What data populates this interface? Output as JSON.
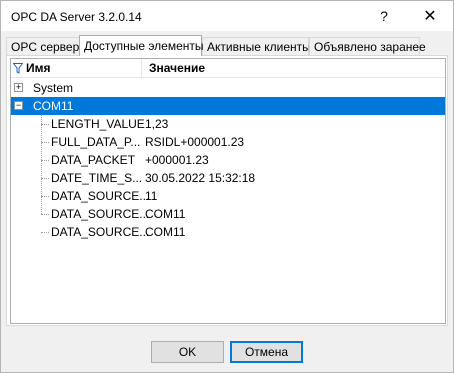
{
  "window": {
    "title": "OPC DA Server 3.2.0.14",
    "help_glyph": "?",
    "close_glyph": "✕"
  },
  "tabs": [
    {
      "label": "OPC сервер",
      "active": false
    },
    {
      "label": "Доступные элементы",
      "active": true
    },
    {
      "label": "Активные клиенты",
      "active": false
    },
    {
      "label": "Объявлено заранее",
      "active": false
    }
  ],
  "grid": {
    "col_name": "Имя",
    "col_value": "Значение",
    "rows": [
      {
        "name": "System",
        "value": "",
        "level": 0,
        "expander": "+",
        "selected": false
      },
      {
        "name": "COM11",
        "value": "",
        "level": 0,
        "expander": "−",
        "selected": true
      },
      {
        "name": "LENGTH_VALUE",
        "value": "1,23",
        "level": 1
      },
      {
        "name": "FULL_DATA_P...",
        "value": "RSIDL+000001.23",
        "level": 1
      },
      {
        "name": "DATA_PACKET",
        "value": "+000001.23",
        "level": 1
      },
      {
        "name": "DATE_TIME_S...",
        "value": "30.05.2022 15:32:18",
        "level": 1
      },
      {
        "name": "DATA_SOURCE...",
        "value": "11",
        "level": 1
      },
      {
        "name": "DATA_SOURCE...",
        "value": "COM11",
        "level": 1
      },
      {
        "name": "DATA_SOURCE...",
        "value": "COM11",
        "level": 1
      }
    ]
  },
  "buttons": {
    "ok": "OK",
    "cancel": "Отмена"
  },
  "colors": {
    "selection": "#0078d7",
    "focus_border": "#0078d7"
  }
}
